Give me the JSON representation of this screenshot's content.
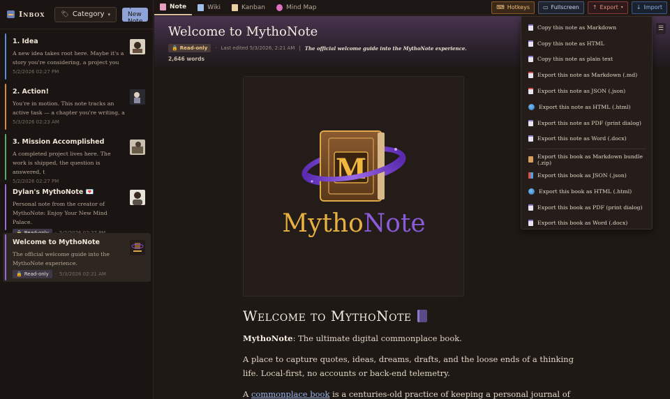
{
  "sidebar": {
    "title": "Inbox",
    "category_label": "Category",
    "new_note_label": "+ New Note",
    "notes": [
      {
        "title": "1. Idea",
        "snippet": "A new idea takes root here. Maybe it's a story you're considering, a project you",
        "date": "5/2/2026 02:27 PM",
        "color": "#5a8ad8"
      },
      {
        "title": "2. Action!",
        "snippet": "You're in motion. This note tracks an active task — a chapter you're writing, a",
        "date": "5/3/2026 02:23 AM",
        "color": "#d88a3a"
      },
      {
        "title": "3. Mission Accomplished",
        "snippet": "A completed project lives here. The work is shipped, the question is answered, t",
        "date": "5/2/2026 02:27 PM",
        "color": "#5aa86a"
      },
      {
        "title": "Dylan's MythoNote 💌",
        "snippet": "Personal note from the creator of MythoNote: Enjoy Your New Mind Palace.",
        "badge": "Read-only",
        "date": "5/2/2026 02:27 PM",
        "color": "#9a6ad8"
      },
      {
        "title": "Welcome to MythoNote",
        "snippet": "The official welcome guide into the MythoNote experience.",
        "badge": "Read-only",
        "date": "5/3/2026 02:21 AM",
        "color": "#9a6ad8"
      }
    ]
  },
  "tabs": [
    {
      "label": "Note",
      "color": "#e8a0c0"
    },
    {
      "label": "Wiki",
      "color": "#a0c0e8"
    },
    {
      "label": "Kanban",
      "color": "#e8d0a0"
    },
    {
      "label": "Mind Map",
      "color": "#e070c0"
    }
  ],
  "actions": {
    "hotkeys": "Hotkeys",
    "fullscreen": "Fullscreen",
    "export": "Export",
    "import": "Import"
  },
  "note": {
    "title": "Welcome to MythoNote",
    "readonly": "Read-only",
    "last_edited": "Last edited 5/3/2026, 2:21 AM",
    "separator": "|",
    "description": "The official welcome guide into the MythoNote experience.",
    "words": "2,646 words",
    "logo_text_a": "Mytho",
    "logo_text_b": "Note",
    "logo_letter": "M",
    "heading": "Welcome to MythoNote",
    "p1_bold": "MythoNote",
    "p1_rest": ": The ultimate digital commonplace book.",
    "p2": "A place to capture quotes, ideas, dreams, drafts, and the loose ends of a thinking life. Local-first, no accounts or back-end telemetry.",
    "p3_start": "A ",
    "p3_link": "commonplace book",
    "p3_rest": " is a centuries-old practice of keeping a personal journal of passages, observations,"
  },
  "export_menu": {
    "note_items": [
      {
        "label": "Copy this note as Markdown",
        "icon": "doc"
      },
      {
        "label": "Copy this note as HTML",
        "icon": "doc"
      },
      {
        "label": "Copy this note as plain text",
        "icon": "doc"
      },
      {
        "label": "Export this note as Markdown (.md)",
        "icon": "red"
      },
      {
        "label": "Export this note as JSON (.json)",
        "icon": "red"
      },
      {
        "label": "Export this note as HTML (.html)",
        "icon": "globe"
      },
      {
        "label": "Export this note as PDF (print dialog)",
        "icon": "doc"
      },
      {
        "label": "Export this note as Word (.docx)",
        "icon": "doc"
      }
    ],
    "book_items": [
      {
        "label": "Export this book as Markdown bundle (.zip)",
        "icon": "box"
      },
      {
        "label": "Export this book as JSON (.json)",
        "icon": "tiles"
      },
      {
        "label": "Export this book as HTML (.html)",
        "icon": "globe"
      },
      {
        "label": "Export this book as PDF (print dialog)",
        "icon": "doc"
      },
      {
        "label": "Export this book as Word (.docx)",
        "icon": "doc"
      }
    ]
  }
}
